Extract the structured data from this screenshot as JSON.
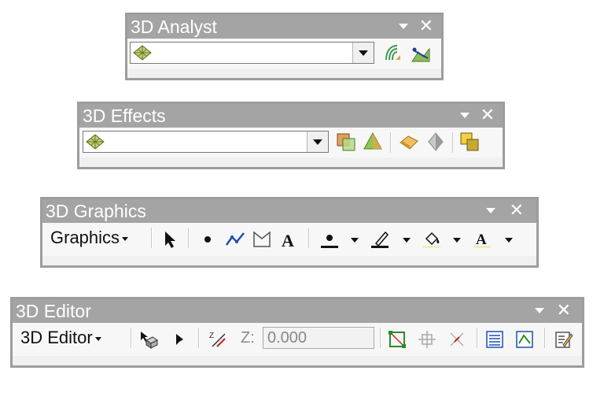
{
  "toolbars": [
    {
      "id": "analyst",
      "title": "3D Analyst",
      "close": "✕"
    },
    {
      "id": "effects",
      "title": "3D Effects",
      "close": "✕"
    },
    {
      "id": "graphics",
      "title": "3D Graphics",
      "close": "✕",
      "menu": "Graphics"
    },
    {
      "id": "editor",
      "title": "3D Editor",
      "close": "✕",
      "menu": "3D Editor",
      "z_label": "Z:",
      "z_value": "0.000"
    }
  ],
  "icons": {
    "layer": "layer-icon",
    "contour": "contour-icon",
    "line_of_sight": "line-of-sight-icon",
    "transparency": "transparency-icon",
    "lighting": "lighting-icon",
    "face_culling": "face-culling-icon",
    "shading": "shading-icon",
    "layer_order": "layer-order-icon",
    "select": "pointer-icon",
    "point": "point-icon",
    "polyline": "polyline-icon",
    "polygon": "polygon-icon",
    "text": "text-icon"
  }
}
